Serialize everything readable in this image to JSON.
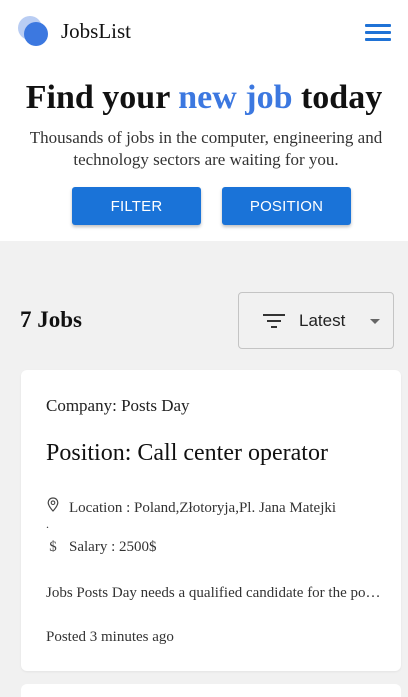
{
  "navbar": {
    "brand": "JobsList",
    "logo_icon": "overlapping-circles-logo",
    "menu_icon": "hamburger-menu-icon",
    "accent_color": "#1a73d8"
  },
  "hero": {
    "title_before": "Find your ",
    "title_accent": "new job",
    "title_after": " today",
    "subtitle": "Thousands of jobs in the computer, engineering and technology sectors are waiting for you.",
    "filter_label": "FILTER",
    "position_label": "POSITION"
  },
  "results": {
    "count_label": "7 Jobs",
    "sort_icon": "filter-lines-icon",
    "sort_value": "Latest"
  },
  "jobs": [
    {
      "company": "Company: Posts Day",
      "position": "Position: Call center operator",
      "location": "Location : Poland,Złotoryja,Pl. Jana Matejki",
      "location_icon": "location-pin-icon",
      "dot": ".",
      "salary": "Salary : 2500$",
      "salary_icon": "dollar-icon",
      "description": "Jobs Posts Day needs a qualified candidate for the position",
      "posted": "Posted 3 minutes ago"
    }
  ]
}
